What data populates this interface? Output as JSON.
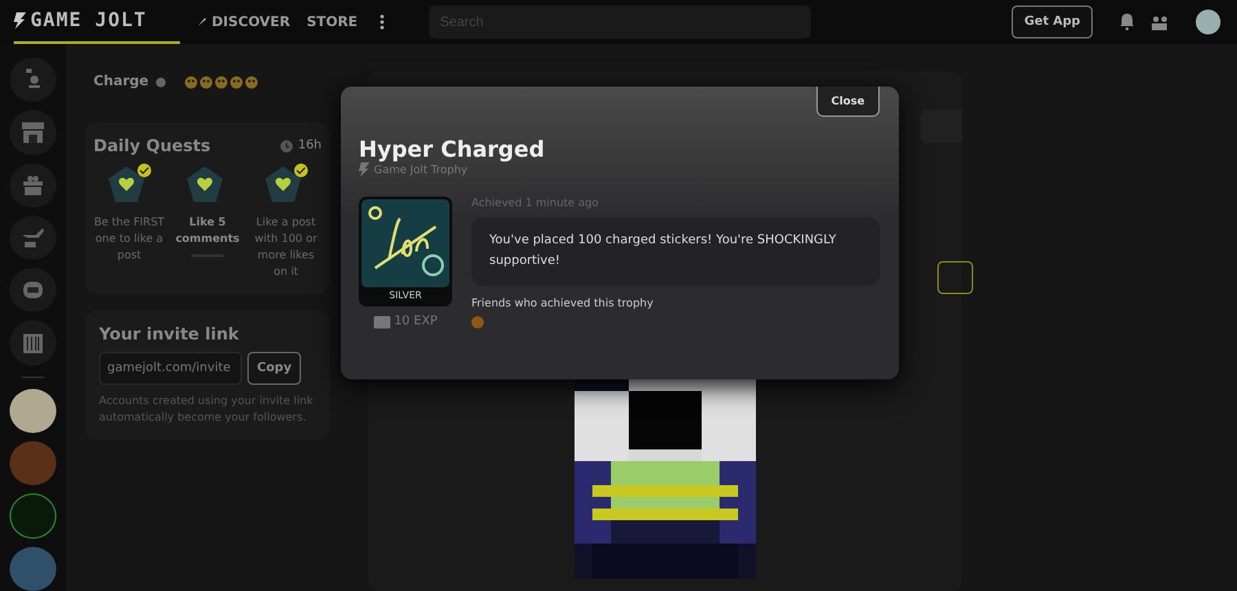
{
  "header": {
    "logo": "GAME JOLT",
    "nav": [
      {
        "label": "DISCOVER",
        "kind": "icon"
      },
      {
        "label": "STORE",
        "kind": "plain"
      }
    ],
    "search": {
      "placeholder": "Search"
    },
    "get_app": "Get App"
  },
  "charge": {
    "label": "Charge"
  },
  "quests": {
    "title": "Daily Quests",
    "timer": "16h",
    "items": [
      {
        "text": "Be the FIRST one to like a post",
        "completed": true
      },
      {
        "text": "Like 5 comments",
        "completed": false
      },
      {
        "text": "Like a post with 100 or more likes on it",
        "completed": true
      }
    ]
  },
  "invite": {
    "title": "Your invite link",
    "value": "gamejolt.com/invite",
    "copy": "Copy",
    "note": "Accounts created using your invite link automatically become your followers."
  },
  "modal": {
    "close": "Close",
    "title": "Hyper Charged",
    "subtitle": "Game Jolt Trophy",
    "tier": "SILVER",
    "exp": "10 EXP",
    "achieved": "Achieved 1 minute ago",
    "description": "You've placed 100 charged stickers! You're SHOCKINGLY supportive!",
    "friends_label": "Friends who achieved this trophy"
  }
}
